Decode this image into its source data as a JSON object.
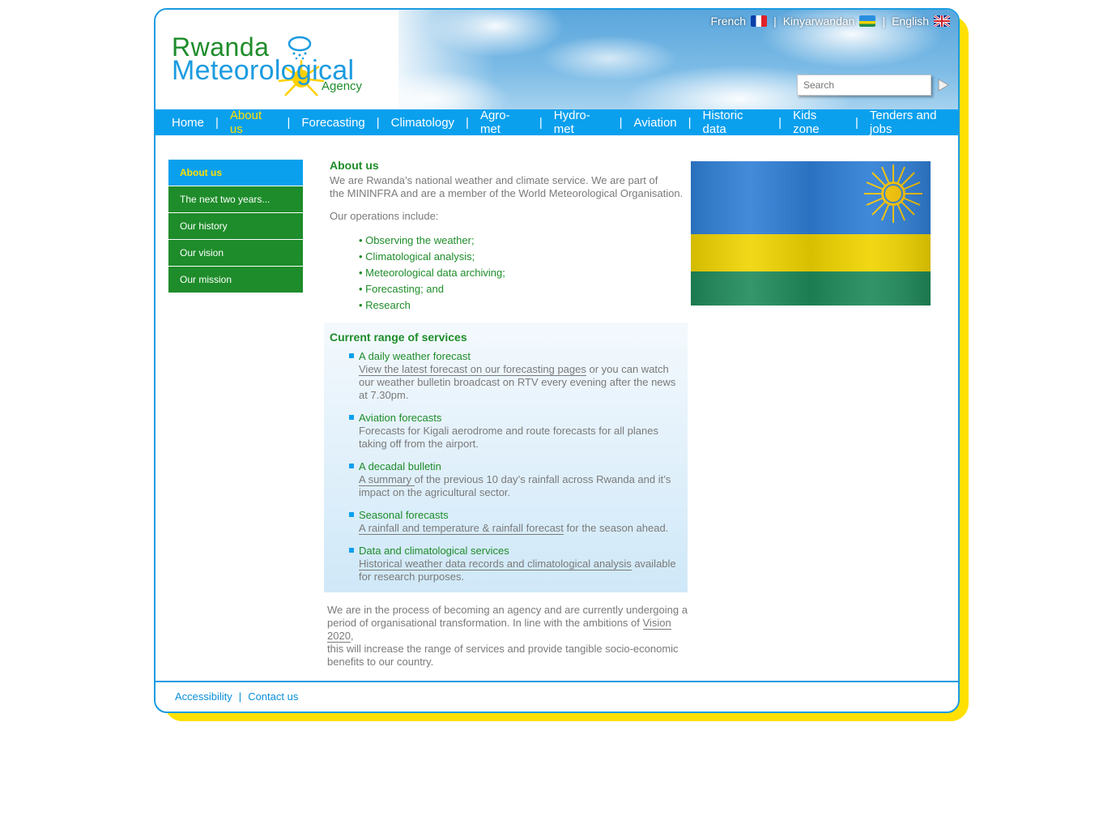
{
  "header": {
    "logo": {
      "line1": "Rwanda",
      "line2": "Meteorological",
      "line3": "Agency"
    },
    "languages": [
      {
        "label": "French",
        "flag": "france-flag-icon"
      },
      {
        "label": "Kinyarwandan",
        "flag": "rwanda-flag-icon"
      },
      {
        "label": "English",
        "flag": "uk-flag-icon"
      }
    ],
    "language_separator": "|",
    "search": {
      "placeholder": "Search"
    }
  },
  "nav": {
    "items": [
      {
        "label": "Home",
        "active": false
      },
      {
        "label": "About us",
        "active": true
      },
      {
        "label": "Forecasting",
        "active": false
      },
      {
        "label": "Climatology",
        "active": false
      },
      {
        "label": "Agro-met",
        "active": false
      },
      {
        "label": "Hydro-met",
        "active": false
      },
      {
        "label": "Aviation",
        "active": false
      },
      {
        "label": "Historic data",
        "active": false
      },
      {
        "label": "Kids zone",
        "active": false
      },
      {
        "label": "Tenders and jobs",
        "active": false
      }
    ],
    "separator": "|"
  },
  "sidebar": {
    "items": [
      {
        "label": "About us",
        "active": true
      },
      {
        "label": "The next two years...",
        "active": false
      },
      {
        "label": "Our history",
        "active": false
      },
      {
        "label": "Our vision",
        "active": false
      },
      {
        "label": "Our mission",
        "active": false
      }
    ]
  },
  "main": {
    "title": "About us",
    "intro_line1": "We are Rwanda’s national weather and climate service.  We are part of",
    "intro_line2": "the MININFRA and are a member of the World Meteorological Organisation.",
    "operations_heading": "Our operations include:",
    "operations": [
      "• Observing the weather;",
      "• Climatological analysis;",
      "• Meteorological data archiving;",
      "• Forecasting; and",
      "• Research"
    ],
    "services": {
      "title": "Current range of services",
      "items": [
        {
          "title": "A daily weather forecast",
          "link": "View the latest forecast on our forecasting pages",
          "text_after_link": " or you can watch",
          "line2": "our weather bulletin broadcast on RTV every evening after the news",
          "line3": "at 7.30pm."
        },
        {
          "title": "Aviation forecasts",
          "line1": "Forecasts for Kigali aerodrome and route forecasts for all planes",
          "line2": "taking off from the airport."
        },
        {
          "title": "A decadal bulletin",
          "link": "A summary ",
          "text_after_link": "of the previous 10 day’s rainfall across Rwanda and it’s",
          "line2": "impact on the agricultural sector."
        },
        {
          "title": "Seasonal forecasts",
          "link": "A rainfall and temperature & rainfall forecast",
          "text_after_link": " for the season ahead."
        },
        {
          "title": "Data and climatological services",
          "link": "Historical weather data records and climatological analysis",
          "text_after_link": " available",
          "line2": "for research purposes."
        }
      ]
    },
    "closing_line1": "We are in the process of becoming an agency and are currently undergoing a",
    "closing_line2_before": "period of organisational transformation. In line with the ambitions of ",
    "closing_link": "Vision 2020",
    "closing_line2_after": ",",
    "closing_line3": "this will increase the range of services and provide tangible socio-economic",
    "closing_line4": "benefits to our country."
  },
  "footer": {
    "links": [
      "Accessibility",
      "Contact us"
    ],
    "separator": "|"
  },
  "colors": {
    "brand_blue": "#0aa0ee",
    "brand_green": "#1e8c2a",
    "brand_yellow": "#ffe000"
  }
}
